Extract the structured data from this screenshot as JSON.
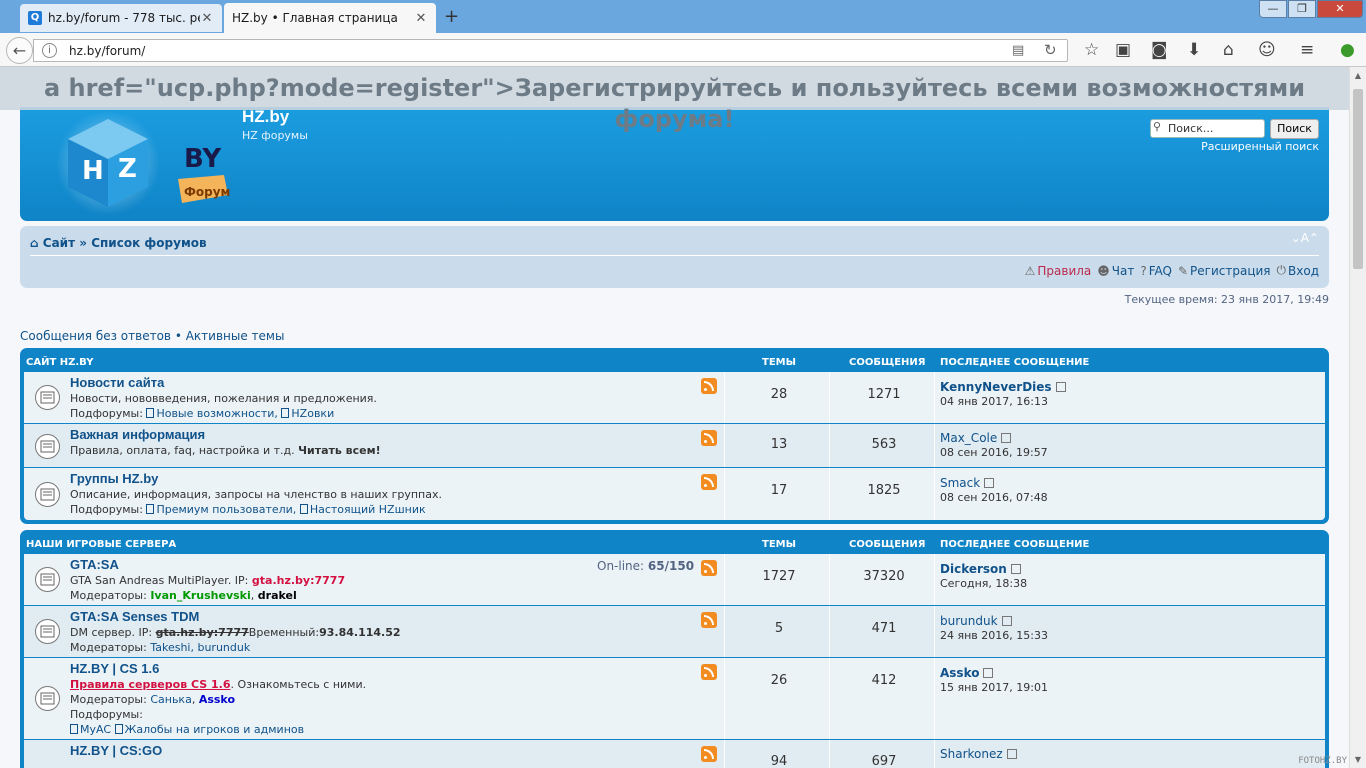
{
  "browser": {
    "tabs": [
      {
        "label": "hz.by/forum - 778 тыс. рез..."
      },
      {
        "label": "HZ.by • Главная страница"
      }
    ],
    "url": "hz.by/forum/",
    "new_tab": "+",
    "window_buttons": {
      "minimize": "—",
      "maximize": "❐",
      "close": "✕"
    }
  },
  "register_banner": "a href=\"ucp.php?mode=register\">Зарегистрируйтесь и пользуйтесь всеми возможностями форума!",
  "header": {
    "site_title": "HZ.by",
    "site_desc": "HZ форумы",
    "search_placeholder": "Поиск...",
    "search_button": "Поиск",
    "advanced_search": "Расширенный поиск",
    "logo_text": "BY",
    "logo_tag": "Форум",
    "logo_cube": "HZ"
  },
  "nav": {
    "breadcrumb_home": "Сайт",
    "breadcrumb_sep": "»",
    "breadcrumb_current": "Список форумов",
    "font_toggle": "⌄A⌃",
    "links": [
      {
        "label": "Правила",
        "icon": "warning-icon"
      },
      {
        "label": "Чат",
        "icon": "users-icon"
      },
      {
        "label": "FAQ",
        "icon": "help-icon"
      },
      {
        "label": "Регистрация",
        "icon": "pen-icon"
      },
      {
        "label": "Вход",
        "icon": "power-icon"
      }
    ]
  },
  "current_time": "Текущее время: 23 янв 2017, 19:49",
  "quick_links": {
    "unanswered": "Сообщения без ответов",
    "sep": " • ",
    "active": "Активные темы"
  },
  "categories": [
    {
      "title": "САЙТ HZ.BY",
      "col_topics": "ТЕМЫ",
      "col_posts": "СООБЩЕНИЯ",
      "col_last": "ПОСЛЕДНЕЕ СООБЩЕНИЕ",
      "forums": [
        {
          "title": "Новости сайта",
          "desc": "Новости, нововведения, пожелания и предложения.",
          "subforums_label": "Подфорумы:",
          "subforums": [
            "Новые возможности,",
            "HZовки"
          ],
          "topics": "28",
          "posts": "1271",
          "last_user": "KennyNeverDies",
          "last_date": "04 янв 2017, 16:13"
        },
        {
          "title": "Важная информация",
          "desc": "Правила, оплата, faq, настройка и т.д.",
          "desc_bold": "Читать всем!",
          "topics": "13",
          "posts": "563",
          "last_user": "Max_Cole",
          "last_date": "08 сен 2016, 19:57"
        },
        {
          "title": "Группы HZ.by",
          "desc": "Описание, информация, запросы на членство в наших группах.",
          "subforums_label": "Подфорумы:",
          "subforums": [
            "Премиум пользователи,",
            "Настоящий HZшник"
          ],
          "topics": "17",
          "posts": "1825",
          "last_user": "Smack",
          "last_date": "08 сен 2016, 07:48"
        }
      ]
    },
    {
      "title": "НАШИ ИГРОВЫЕ СЕРВЕРА",
      "col_topics": "ТЕМЫ",
      "col_posts": "СООБЩЕНИЯ",
      "col_last": "ПОСЛЕДНЕЕ СООБЩЕНИЕ",
      "forums": [
        {
          "title": "GTA:SA",
          "online_label": "On-line:",
          "online_value": "65/150",
          "desc": "GTA San Andreas MultiPlayer. IP:",
          "desc_ip": "gta.hz.by:7777",
          "mods_label": "Модераторы:",
          "mod1": "Ivan_Krushevski",
          "mod_sep": ",",
          "mod2": "drakel",
          "topics": "1727",
          "posts": "37320",
          "last_user": "Dickerson",
          "last_date": "Сегодня, 18:38"
        },
        {
          "title": "GTA:SA Senses TDM",
          "desc": "DM сервер. IP:",
          "desc_old_ip": "gta.hz.by:7777",
          "desc_temp": "Временный:",
          "desc_new_ip": "93.84.114.52",
          "mods_label": "Модераторы:",
          "mods": "Takeshi, burunduk",
          "topics": "5",
          "posts": "471",
          "last_user": "burunduk",
          "last_date": "24 янв 2016, 15:33"
        },
        {
          "title": "HZ.BY | CS 1.6",
          "rules_link": "Правила серверов CS 1.6",
          "rules_after": ". Ознакомьтесь с ними.",
          "mods_label": "Модераторы:",
          "mod1": "Санька",
          "mod_sep": ",",
          "mod2": "Assko",
          "subforums_label": "Подфорумы:",
          "subforums": [
            "MyAC",
            "Жалобы на игроков и админов"
          ],
          "topics": "26",
          "posts": "412",
          "last_user": "Assko",
          "last_date": "15 янв 2017, 19:01"
        },
        {
          "title": "HZ.BY | CS:GO",
          "topics": "94",
          "posts": "697",
          "last_user": "Sharkonez"
        }
      ]
    }
  ],
  "watermark": "FOTOHZ.BY",
  "colors": {
    "header_blue": "#1b9de0",
    "link": "#105289",
    "nav_bg": "#cadceb",
    "rss": "#f28b20"
  }
}
